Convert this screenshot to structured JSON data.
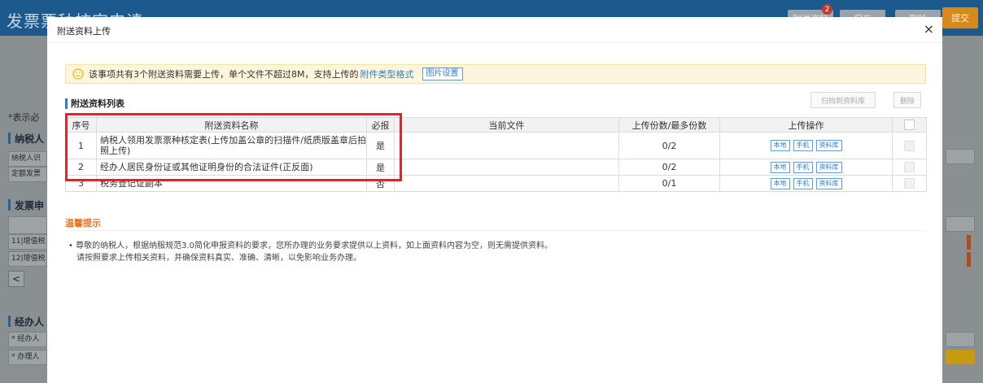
{
  "background": {
    "title": "发票票种核定申请",
    "header_buttons": [
      "附送资料",
      "保存",
      "删除"
    ],
    "badge_count": "2",
    "submit_label": "提交",
    "required_hint": "*表示必",
    "sections": [
      "纳税人",
      "发票申",
      "经办人"
    ],
    "rows": {
      "taxpayer_1": "纳税人识",
      "taxpayer_2": "定额发票",
      "invoice_1": "11|增值税",
      "invoice_2": "12|增值税",
      "agent_1": "* 经办人",
      "agent_2": "* 办理人"
    },
    "prev_label": "<"
  },
  "modal": {
    "title": "附送资料上传",
    "close_label": "×",
    "notice": {
      "text": "该事项共有3个附送资料需要上传，单个文件不超过8M，支持上传的",
      "link": "附件类型格式",
      "button": "图片设置"
    },
    "list_title": "附送资料列表",
    "buttons": {
      "archive": "归档到资料库",
      "delete": "删除"
    },
    "table": {
      "headers": [
        "序号",
        "附送资料名称",
        "必报",
        "当前文件",
        "上传份数/最多份数",
        "上传操作"
      ],
      "rows": [
        {
          "no": "1",
          "name": "纳税人领用发票票种核定表(上传加盖公章的扫描件/纸质版盖章后拍照上传)",
          "required": "是",
          "file": "",
          "count": "0/2"
        },
        {
          "no": "2",
          "name": "经办人居民身份证或其他证明身份的合法证件(正反面)",
          "required": "是",
          "file": "",
          "count": "0/2"
        },
        {
          "no": "3",
          "name": "税务登记证副本",
          "required": "否",
          "file": "",
          "count": "0/1"
        }
      ],
      "ops": [
        "本地",
        "手机",
        "资料库"
      ]
    },
    "tips": {
      "title": "温馨提示",
      "line1": "• 尊敬的纳税人，根据纳服规范3.0简化申报资料的要求，您所办理的业务要求提供以上资料，如上面资料内容为空，则无需提供资料。",
      "line2": "请按照要求上传相关资料，并确保资料真实、准确、清晰，以免影响业务办理。"
    }
  },
  "colors": {
    "accent": "#2f7ec8",
    "highlight": "#e0242a",
    "tips": "#e8731f",
    "notice_bg": "#fdf6dd"
  }
}
